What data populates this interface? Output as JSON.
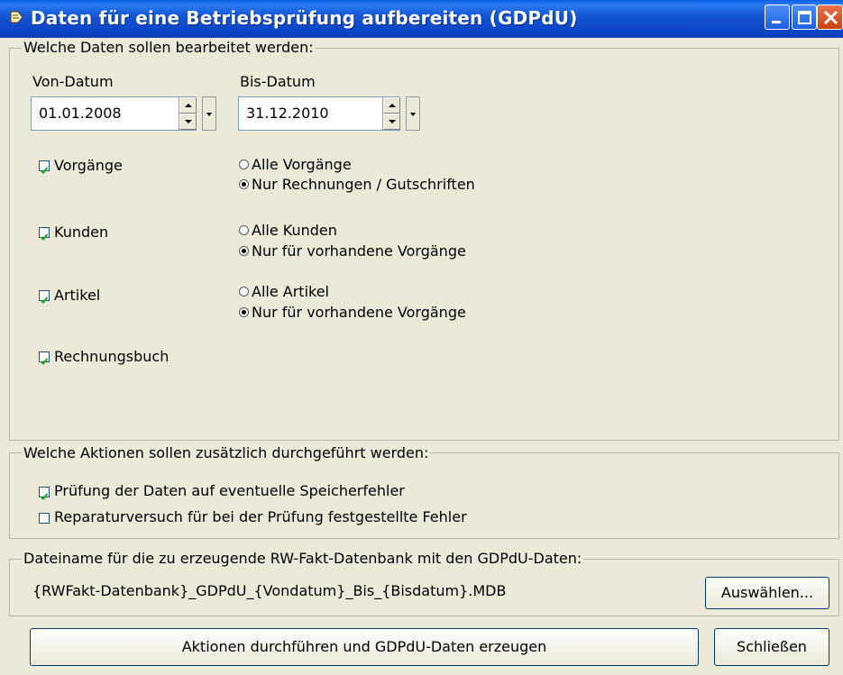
{
  "window": {
    "title": "Daten für eine Betriebsprüfung aufbereiten (GDPdU)"
  },
  "data_group": {
    "legend": "Welche Daten sollen bearbeitet werden:",
    "from_label": "Von-Datum",
    "from_value": "01.01.2008",
    "to_label": "Bis-Datum",
    "to_value": "31.12.2010",
    "items": [
      {
        "label": "Vorgänge",
        "checked": true,
        "options": [
          {
            "label": "Alle Vorgänge",
            "selected": false
          },
          {
            "label": "Nur Rechnungen / Gutschriften",
            "selected": true
          }
        ]
      },
      {
        "label": "Kunden",
        "checked": true,
        "options": [
          {
            "label": "Alle Kunden",
            "selected": false
          },
          {
            "label": "Nur für vorhandene Vorgänge",
            "selected": true
          }
        ]
      },
      {
        "label": "Artikel",
        "checked": true,
        "options": [
          {
            "label": "Alle Artikel",
            "selected": false
          },
          {
            "label": "Nur für vorhandene Vorgänge",
            "selected": true
          }
        ]
      },
      {
        "label": "Rechnungsbuch",
        "checked": true,
        "options": []
      }
    ]
  },
  "actions_group": {
    "legend": "Welche Aktionen sollen zusätzlich durchgeführt werden:",
    "items": [
      {
        "label": "Prüfung der Daten auf eventuelle Speicherfehler",
        "checked": true
      },
      {
        "label": "Reparaturversuch für bei der Prüfung festgestellte Fehler",
        "checked": false
      }
    ]
  },
  "file_group": {
    "legend": "Dateiname für die zu erzeugende RW-Fakt-Datenbank mit den GDPdU-Daten:",
    "filename": "{RWFakt-Datenbank}_GDPdU_{Vondatum}_Bis_{Bisdatum}.MDB",
    "choose_label": "Auswählen..."
  },
  "footer": {
    "run_label": "Aktionen durchführen und GDPdU-Daten erzeugen",
    "close_label": "Schließen"
  },
  "colors": {
    "titlebar": "#0a44c4",
    "face": "#ece9d8",
    "close_button": "#c9410e"
  }
}
